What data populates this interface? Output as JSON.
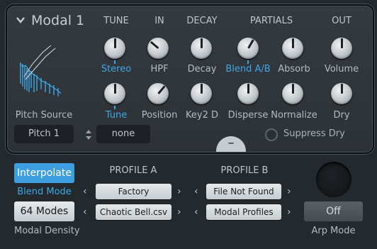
{
  "module": {
    "title": "Modal 1"
  },
  "headers": {
    "tune": "TUNE",
    "in": "IN",
    "decay": "DECAY",
    "partials": "PARTIALS",
    "out": "OUT"
  },
  "knobs_top": [
    {
      "label": "Stereo",
      "highlight": true
    },
    {
      "label": "HPF",
      "highlight": false
    },
    {
      "label": "Decay",
      "highlight": false
    },
    {
      "label": "Blend A/B",
      "highlight": true
    },
    {
      "label": "Absorb",
      "highlight": false
    },
    {
      "label": "Volume",
      "highlight": false
    }
  ],
  "knobs_bottom": [
    {
      "label": "Tune",
      "highlight": true
    },
    {
      "label": "Position",
      "highlight": false
    },
    {
      "label": "Key2 D",
      "highlight": false
    },
    {
      "label": "Disperse",
      "highlight": false
    },
    {
      "label": "Normalize",
      "highlight": false
    },
    {
      "label": "Dry",
      "highlight": false
    }
  ],
  "pitch": {
    "label": "Pitch Source",
    "source": "Pitch 1",
    "mod": "none"
  },
  "suppress": {
    "label": "Suppress Dry"
  },
  "collapse": {
    "glyph": "–"
  },
  "bottom": {
    "interpolate": "Interpolate",
    "blend_mode": "Blend Mode",
    "modes": "64 Modes",
    "modal_density": "Modal Density",
    "profile_a": "PROFILE A",
    "profile_b": "PROFILE B",
    "a_bank": "Factory",
    "a_file": "Chaotic Bell.csv",
    "b_bank": "File Not Found",
    "b_file": "Modal Profiles",
    "arp_value": "Off",
    "arp_label": "Arp Mode"
  },
  "colors": {
    "accent": "#3da7e8",
    "bg": "#24292d",
    "panel": "#31373b"
  }
}
